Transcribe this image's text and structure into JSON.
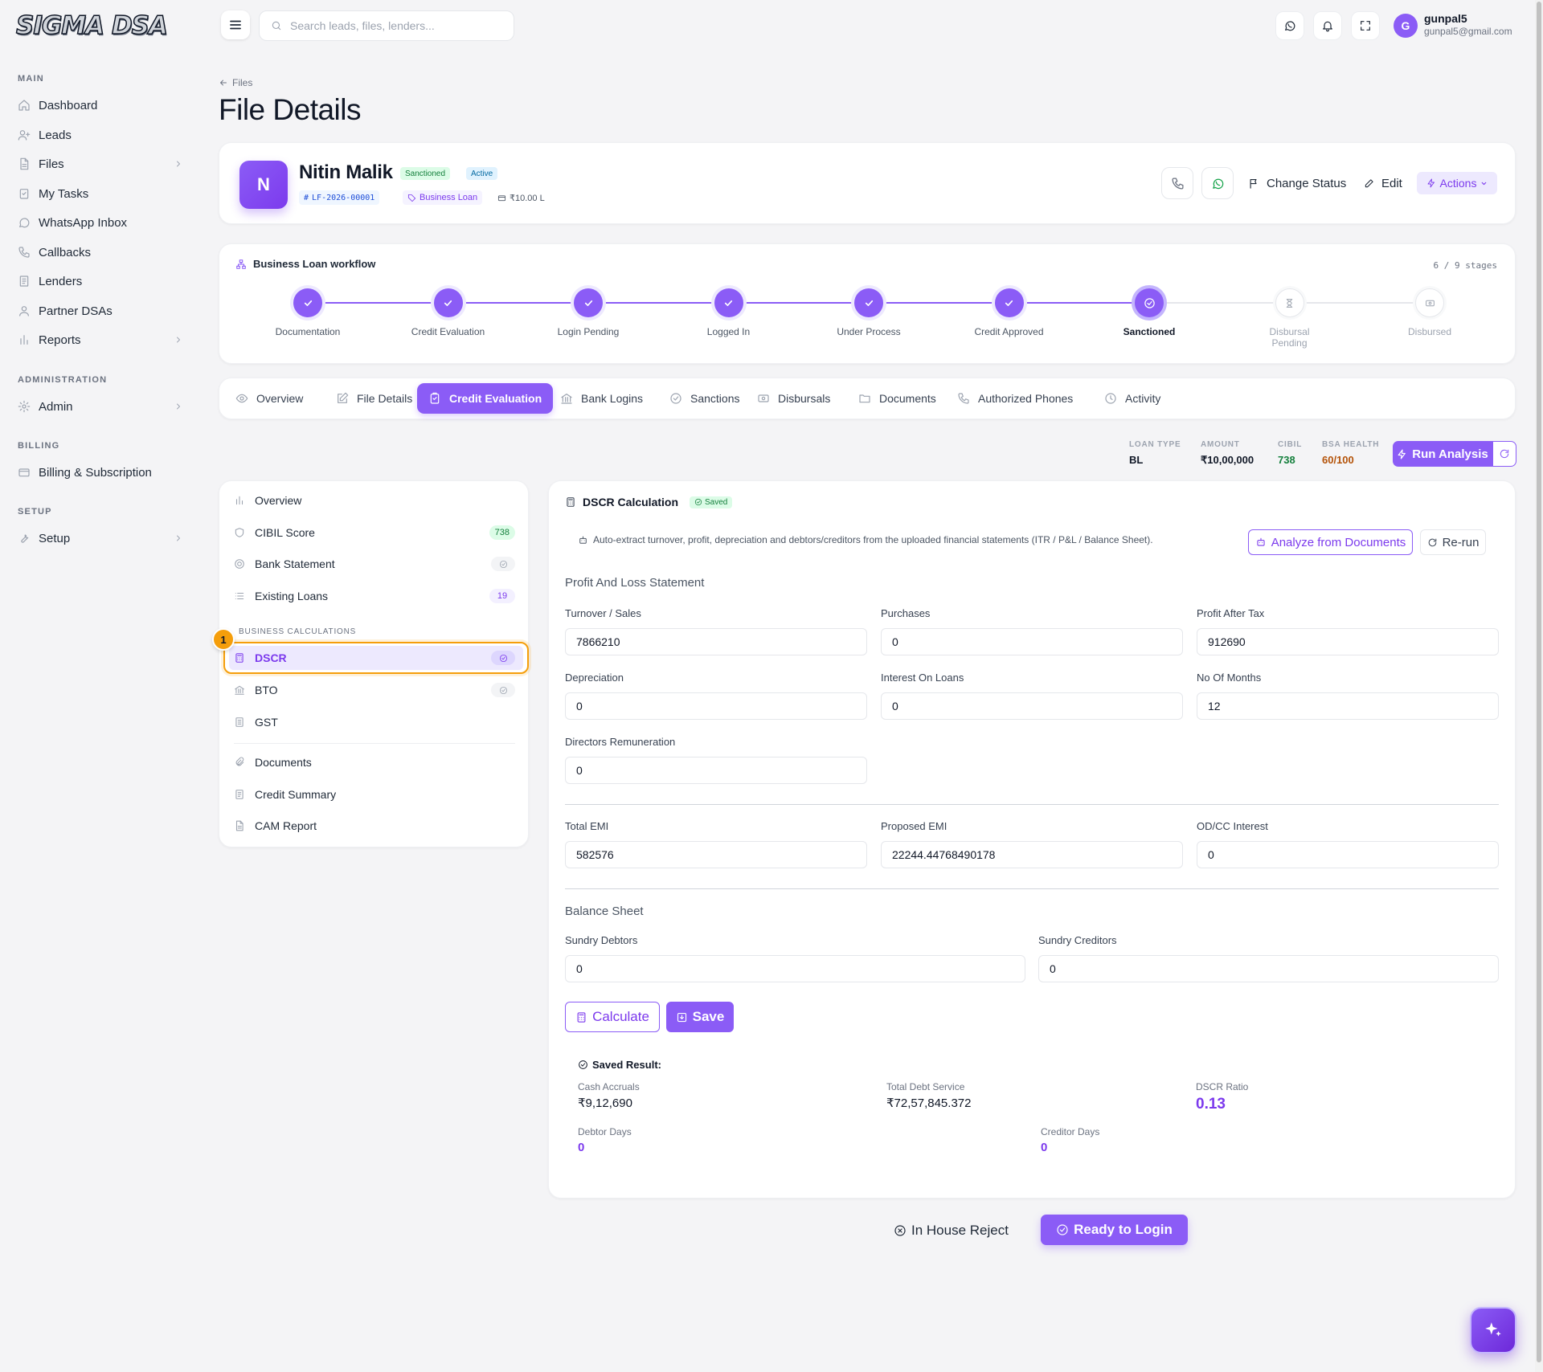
{
  "brand": {
    "logo_text": "SIGMA DSA"
  },
  "sidebar": {
    "sections": {
      "main": "MAIN",
      "administration": "ADMINISTRATION",
      "billing": "BILLING",
      "setup": "SETUP"
    },
    "items": [
      {
        "label": "Dashboard",
        "icon": "home-icon"
      },
      {
        "label": "Leads",
        "icon": "user-plus-icon"
      },
      {
        "label": "Files",
        "icon": "file-icon"
      },
      {
        "label": "My Tasks",
        "icon": "clipboard-check-icon"
      },
      {
        "label": "WhatsApp Inbox",
        "icon": "whatsapp-icon"
      },
      {
        "label": "Callbacks",
        "icon": "phone-icon"
      },
      {
        "label": "Lenders",
        "icon": "document-icon"
      },
      {
        "label": "Partner DSAs",
        "icon": "users-icon"
      },
      {
        "label": "Reports",
        "icon": "bar-chart-icon"
      },
      {
        "label": "Admin",
        "icon": "gear-icon"
      },
      {
        "label": "Billing & Subscription",
        "icon": "credit-card-icon"
      },
      {
        "label": "Setup",
        "icon": "wrench-icon"
      }
    ]
  },
  "topbar": {
    "search_placeholder": "Search leads, files, lenders...",
    "user": {
      "initial": "G",
      "name": "gunpal5",
      "email": "gunpal5@gmail.com"
    }
  },
  "header": {
    "breadcrumb": "Files",
    "title": "File Details"
  },
  "profile": {
    "initial": "N",
    "name": "Nitin Malik",
    "status_badge": "Sanctioned",
    "state_badge": "Active",
    "file_id": "LF-2026-00001",
    "loan_type": "Business Loan",
    "amount": "₹10.00 L",
    "buttons": {
      "change_status": "Change Status",
      "edit": "Edit",
      "actions": "Actions"
    }
  },
  "workflow": {
    "title": "Business Loan workflow",
    "count": "6 / 9 stages",
    "progress_fraction": 0.75,
    "stages": [
      {
        "label": "Documentation",
        "state": "done"
      },
      {
        "label": "Credit Evaluation",
        "state": "done"
      },
      {
        "label": "Login Pending",
        "state": "done"
      },
      {
        "label": "Logged In",
        "state": "done"
      },
      {
        "label": "Under Process",
        "state": "done"
      },
      {
        "label": "Credit Approved",
        "state": "done"
      },
      {
        "label": "Sanctioned",
        "state": "current"
      },
      {
        "label": "Disbursal Pending",
        "state": "todo"
      },
      {
        "label": "Disbursed",
        "state": "todo"
      }
    ]
  },
  "tabs": [
    {
      "label": "Overview",
      "icon": "eye-icon"
    },
    {
      "label": "File Details",
      "icon": "edit-icon"
    },
    {
      "label": "Credit Evaluation",
      "icon": "clipboard-icon"
    },
    {
      "label": "Bank Logins",
      "icon": "bank-icon"
    },
    {
      "label": "Sanctions",
      "icon": "check-circle-icon"
    },
    {
      "label": "Disbursals",
      "icon": "cash-icon"
    },
    {
      "label": "Documents",
      "icon": "folder-icon"
    },
    {
      "label": "Authorized Phones",
      "icon": "phone-icon"
    },
    {
      "label": "Activity",
      "icon": "clock-icon"
    }
  ],
  "summary": {
    "loan_type_label": "LOAN TYPE",
    "loan_type": "BL",
    "amount_label": "AMOUNT",
    "amount": "₹10,00,000",
    "cibil_label": "CIBIL",
    "cibil": "738",
    "bsa_label": "BSA HEALTH",
    "bsa": "60/100",
    "run_analysis": "Run Analysis",
    "colors": {
      "cibil": "#15803d",
      "bsa": "#b45309"
    }
  },
  "left_panel": {
    "items": [
      {
        "label": "Overview",
        "icon": "bar-chart-icon"
      },
      {
        "label": "CIBIL Score",
        "icon": "shield-icon",
        "badge": "738"
      },
      {
        "label": "Bank Statement",
        "icon": "circle-icon"
      },
      {
        "label": "Existing Loans",
        "icon": "list-icon",
        "badge": "19"
      }
    ],
    "section_label": "BUSINESS CALCULATIONS",
    "calc_items": [
      {
        "label": "DSCR",
        "icon": "calculator-icon"
      },
      {
        "label": "BTO",
        "icon": "bank-icon"
      },
      {
        "label": "GST",
        "icon": "receipt-icon"
      }
    ],
    "bottom_items": [
      {
        "label": "Documents",
        "icon": "paperclip-icon"
      },
      {
        "label": "Credit Summary",
        "icon": "document-icon"
      },
      {
        "label": "CAM Report",
        "icon": "file-text-icon"
      }
    ],
    "marker": "1"
  },
  "dscr": {
    "title": "DSCR Calculation",
    "saved_badge": "Saved",
    "note": "Auto-extract turnover, profit, depreciation and debtors/creditors from the uploaded financial statements (ITR / P&L / Balance Sheet).",
    "analyze_button": "Analyze from Documents",
    "rerun_button": "Re-run",
    "pl_section": "Profit And Loss Statement",
    "fields": {
      "turnover": {
        "label": "Turnover / Sales",
        "value": "7866210"
      },
      "purchases": {
        "label": "Purchases",
        "value": "0"
      },
      "pat": {
        "label": "Profit After Tax",
        "value": "912690"
      },
      "depreciation": {
        "label": "Depreciation",
        "value": "0"
      },
      "interest": {
        "label": "Interest On Loans",
        "value": "0"
      },
      "months": {
        "label": "No Of Months",
        "value": "12"
      },
      "directors": {
        "label": "Directors Remuneration",
        "value": "0"
      },
      "total_emi": {
        "label": "Total EMI",
        "value": "582576"
      },
      "proposed_emi": {
        "label": "Proposed EMI",
        "value": "22244.44768490178"
      },
      "odcc": {
        "label": "OD/CC Interest",
        "value": "0"
      },
      "debtors": {
        "label": "Sundry Debtors",
        "value": "0"
      },
      "creditors": {
        "label": "Sundry Creditors",
        "value": "0"
      }
    },
    "bs_section": "Balance Sheet",
    "calculate_button": "Calculate",
    "save_button": "Save",
    "result": {
      "title": "Saved Result:",
      "cash_accruals_label": "Cash Accruals",
      "cash_accruals": "₹9,12,690",
      "debt_service_label": "Total Debt Service",
      "debt_service": "₹72,57,845.372",
      "dscr_label": "DSCR Ratio",
      "dscr": "0.13",
      "debtor_days_label": "Debtor Days",
      "debtor_days": "0",
      "creditor_days_label": "Creditor Days",
      "creditor_days": "0"
    }
  },
  "footer_actions": {
    "reject": "In House Reject",
    "ready": "Ready to Login"
  }
}
